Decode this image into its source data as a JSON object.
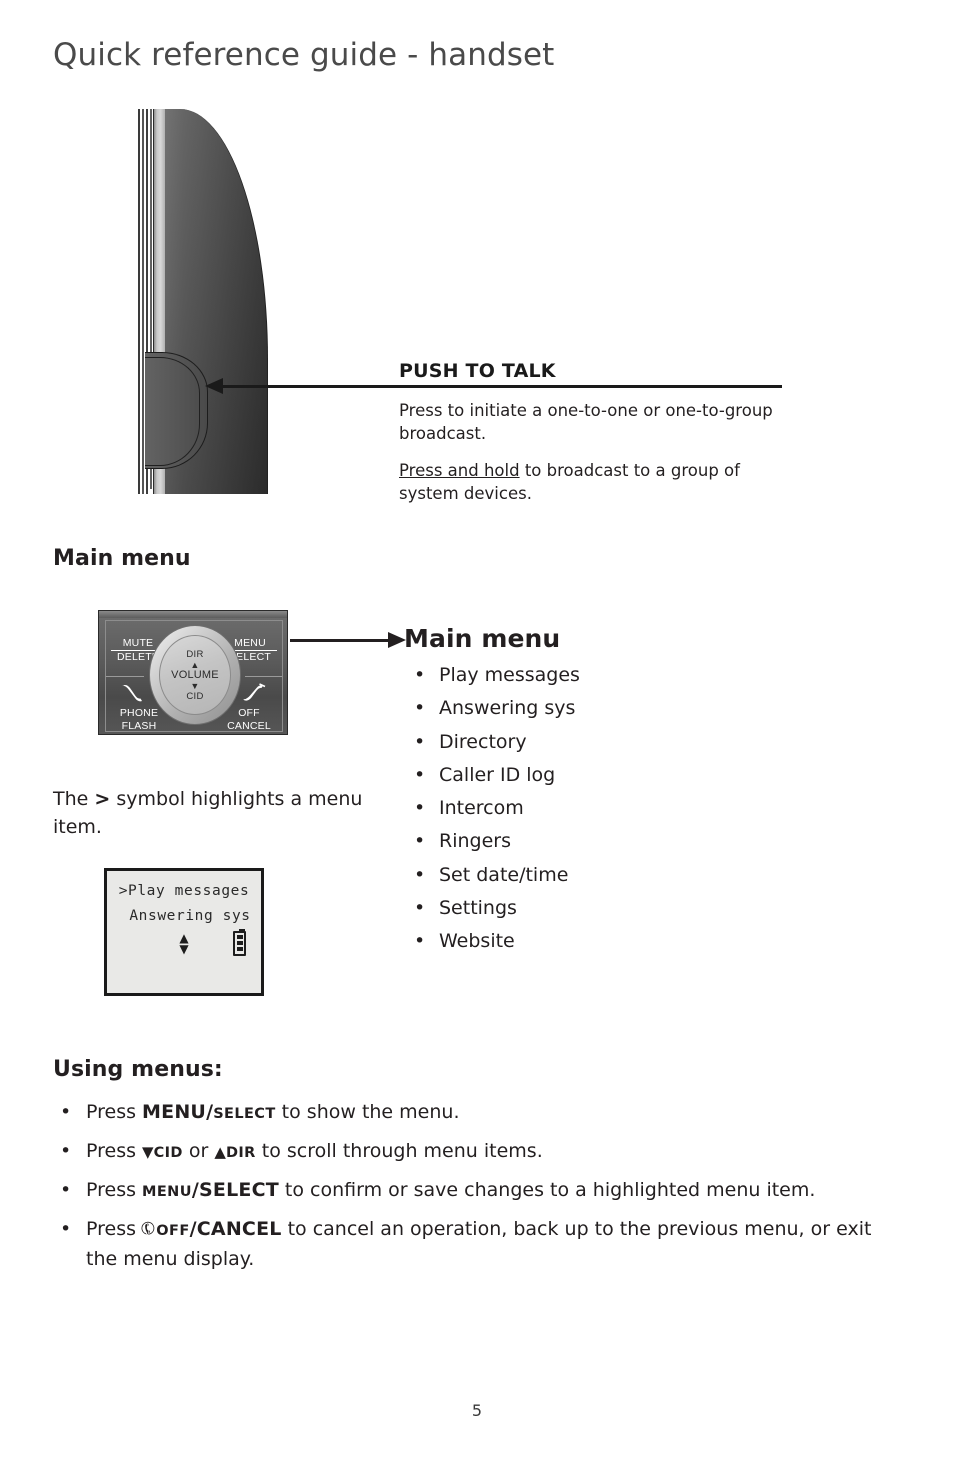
{
  "page": {
    "title": "Quick reference guide - handset",
    "number": "5"
  },
  "handset": {
    "button_label_lines": [
      "PUSH",
      "TO",
      "TALK"
    ],
    "callout": {
      "title": "PUSH TO TALK",
      "paragraph1": "Press to initiate a one-to-one or one-to-group broadcast.",
      "paragraph2_underlined": "Press and hold",
      "paragraph2_rest": " to broadcast to a group of system devices."
    }
  },
  "main_menu_section": {
    "heading": "Main menu",
    "keypad": {
      "mute_top": "MUTE",
      "mute_bottom": "DELETE",
      "menu_top": "MENU",
      "menu_bottom": "SELECT",
      "phone_top": "PHONE",
      "phone_bottom": "FLASH",
      "off_top": "OFF",
      "off_bottom": "CANCEL",
      "nav_up": "DIR",
      "nav_center": "VOLUME",
      "nav_down": "CID",
      "up_triangle": "▲",
      "down_triangle": "▼"
    },
    "callout_title": "Main menu",
    "items": [
      "Play messages",
      "Answering sys",
      "Directory",
      "Caller ID log",
      "Intercom",
      "Ringers",
      "Set date/time",
      "Settings",
      "Website"
    ],
    "symbol_note_pre": "The ",
    "symbol_note_symbol": ">",
    "symbol_note_post": " symbol highlights a menu item.",
    "lcd": {
      "line1": ">Play messages",
      "line2": "Answering sys",
      "scroll_arrows": "▲▼"
    }
  },
  "using_menus": {
    "heading": "Using menus:",
    "bullets": [
      {
        "pre": "Press ",
        "key_large": "MENU/",
        "key_small": "SELECT",
        "post": " to show the menu."
      },
      {
        "pre": "Press ",
        "tri_down": "▼",
        "key_small_1": "CID",
        "mid": " or ",
        "tri_up": "▲",
        "key_small_2": "DIR",
        "post": " to scroll through menu items."
      },
      {
        "pre": "Press ",
        "key_small": "MENU",
        "key_large": "/SELECT",
        "post": " to confirm or save changes to a highlighted menu item."
      },
      {
        "pre": "Press ",
        "handset_glyph": "✆",
        "key_small": "OFF",
        "key_large": "/CANCEL",
        "post": " to cancel an operation, back up to the previous menu, or exit the menu display."
      }
    ]
  },
  "colors": {
    "text": "#231f20",
    "title_gray": "#4a4a4a",
    "lcd_background": "#e9e9e7",
    "handset_dark": "#4f4f4f",
    "handset_silver": "#d8d8d8"
  }
}
